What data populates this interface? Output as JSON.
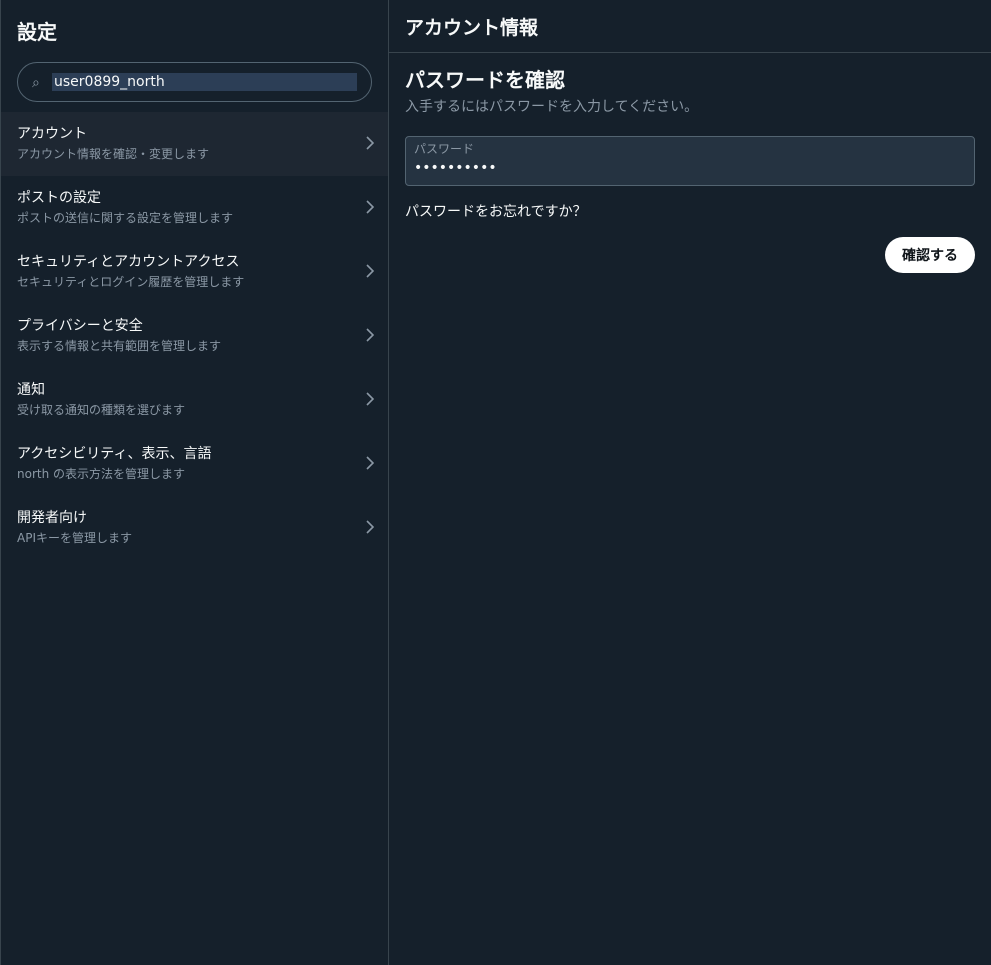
{
  "sidebar": {
    "title": "設定",
    "search": {
      "value": "user0899_north",
      "icon": "search-icon"
    },
    "items": [
      {
        "label": "アカウント",
        "sub": "アカウント情報を確認・変更します"
      },
      {
        "label": "ポストの設定",
        "sub": "ポストの送信に関する設定を管理します"
      },
      {
        "label": "セキュリティとアカウントアクセス",
        "sub": "セキュリティとログイン履歴を管理します"
      },
      {
        "label": "プライバシーと安全",
        "sub": "表示する情報と共有範囲を管理します"
      },
      {
        "label": "通知",
        "sub": "受け取る通知の種類を選びます"
      },
      {
        "label": "アクセシビリティ、表示、言語",
        "sub": "north の表示方法を管理します"
      },
      {
        "label": "開発者向け",
        "sub": "APIキーを管理します"
      }
    ],
    "active_index": 0
  },
  "main": {
    "header": "アカウント情報",
    "section_title": "パスワードを確認",
    "section_desc": "入手するにはパスワードを入力してください。",
    "password": {
      "label": "パスワード",
      "value": "••••••••••"
    },
    "forgot": "パスワードをお忘れですか？",
    "confirm_label": "確認する"
  },
  "colors": {
    "background": "#15202b",
    "active_row": "#1e2732",
    "muted_text": "#8b98a5",
    "border": "#38444d"
  }
}
